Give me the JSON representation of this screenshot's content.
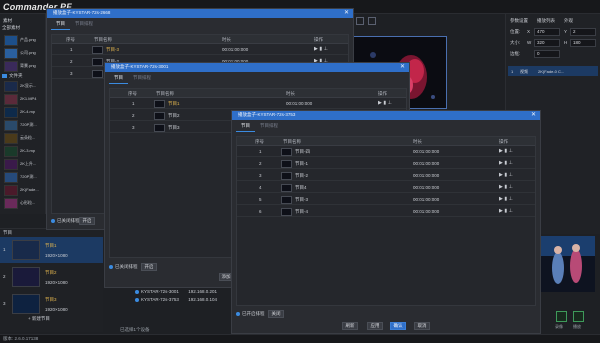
{
  "app": {
    "brand": "Commander PF",
    "status_text": "版本: 2.6.0.17138",
    "new_program_label": "+ 新建节目"
  },
  "left_panel": {
    "header": "素材",
    "folder_label": "全部素材",
    "subfolder_label": "文件夹",
    "assets": [
      {
        "name": "产品.png"
      },
      {
        "name": "公司.png"
      },
      {
        "name": "背景.png"
      },
      {
        "name": "2K显示..."
      },
      {
        "name": "2K1.MP4"
      },
      {
        "name": "2K-4.mp"
      },
      {
        "name": "720P测..."
      },
      {
        "name": "云朵粒..."
      },
      {
        "name": "2K-3.mp"
      },
      {
        "name": "2K上升..."
      },
      {
        "name": "720P测..."
      },
      {
        "name": "2K(Fade..."
      },
      {
        "name": "心形粒..."
      }
    ]
  },
  "program_panel": {
    "header": "节目",
    "items": [
      {
        "num": "1",
        "name": "节目1",
        "res": "1920×1080",
        "selected": true
      },
      {
        "num": "2",
        "name": "节目2",
        "res": "1920×1080",
        "selected": false
      },
      {
        "num": "3",
        "name": "节目3",
        "res": "1920×1080",
        "selected": false
      }
    ]
  },
  "right_panel": {
    "tabs": [
      "参数设置",
      "播放列表",
      "外观"
    ],
    "fields": {
      "pos_label": "位置:",
      "x_label": "X",
      "x_value": "470",
      "y_label": "Y",
      "y_value": "2",
      "size_label": "大小:",
      "w_label": "W",
      "w_value": "320",
      "h_label": "H",
      "h_value": "180",
      "opacity_label": "边框:",
      "opacity_value": "0"
    },
    "list_row": {
      "num": "1",
      "type": "视频",
      "name": "2K(Fade-0 C..."
    },
    "bottom_labels": [
      "录像",
      "播放"
    ]
  },
  "bg_outputs": [
    {
      "name": "KYSTAR-72s-3001",
      "ip": "192.168.0.201"
    },
    {
      "name": "KYSTAR-72s-3753",
      "ip": "192.168.0.104"
    }
  ],
  "bg_count_text": "已选择1个设备",
  "dialog1": {
    "title": "播放盒子-KYSTAR-72s-2668",
    "tabs": [
      "节目",
      "节目排程"
    ],
    "headers": [
      "序号",
      "节目名称",
      "时长",
      "操作"
    ],
    "rows": [
      {
        "num": "1",
        "name": "节目-3",
        "dur": "00:01:00:000",
        "highlight": true
      },
      {
        "num": "2",
        "name": "节目-2",
        "dur": "00:01:00:000",
        "highlight": false
      },
      {
        "num": "3",
        "name": "节目1",
        "dur": "00:01:00:000",
        "highlight": false
      }
    ],
    "toggle_label": "已关闭排程",
    "toggle_button": "开启"
  },
  "dialog2": {
    "title": "播放盒子-KYSTAR-72s-3001",
    "tabs": [
      "节目",
      "节目排程"
    ],
    "headers": [
      "序号",
      "节目名称",
      "时长",
      "操作"
    ],
    "rows": [
      {
        "num": "1",
        "name": "节目1",
        "dur": "00:01:00:000",
        "highlight": true
      },
      {
        "num": "2",
        "name": "节目2",
        "dur": "00:01:00:000",
        "highlight": false
      },
      {
        "num": "3",
        "name": "节目3",
        "dur": "00:01:00:000",
        "highlight": false
      }
    ],
    "toggle_label": "已关闭排程",
    "toggle_button": "开启",
    "footer_button": "添加"
  },
  "dialog3": {
    "title": "播放盒子-KYSTAR-72s-3753",
    "tabs": [
      "节目",
      "节目排程"
    ],
    "headers": [
      "序号",
      "节目名称",
      "时长",
      "操作"
    ],
    "rows": [
      {
        "num": "1",
        "name": "节目-四",
        "dur": "00:01:00:000"
      },
      {
        "num": "2",
        "name": "节目-1",
        "dur": "00:01:00:000"
      },
      {
        "num": "3",
        "name": "节目-2",
        "dur": "00:01:00:000"
      },
      {
        "num": "4",
        "name": "节目4",
        "dur": "00:01:00:000"
      },
      {
        "num": "5",
        "name": "节目-3",
        "dur": "00:01:00:000"
      },
      {
        "num": "6",
        "name": "节目-4",
        "dur": "00:01:00:000"
      }
    ],
    "toggle_label": "已开启排程",
    "toggle_button": "关闭",
    "buttons": {
      "add": "刷新",
      "apply": "应用",
      "ok": "确认",
      "cancel": "取消"
    }
  },
  "colors": {
    "accent": "#2f6fc9",
    "highlight_text": "#e3b64f",
    "selection": "#1c3a63"
  }
}
